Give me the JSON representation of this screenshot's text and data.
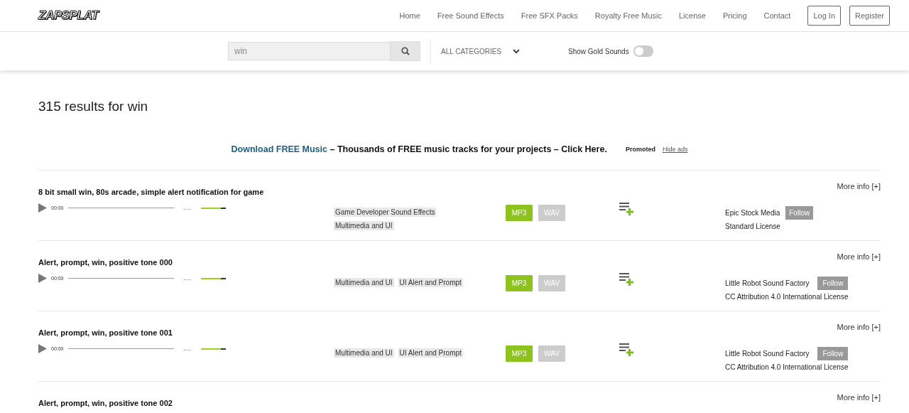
{
  "logo": "ZAPSPLAT",
  "nav": [
    "Home",
    "Free Sound Effects",
    "Free SFX Packs",
    "Royalty Free Music",
    "License",
    "Pricing",
    "Contact"
  ],
  "auth_buttons": [
    "Log In",
    "Register"
  ],
  "search": {
    "value": "win",
    "category": "ALL CATEGORIES",
    "gold_label": "Show Gold Sounds",
    "gold_on": false
  },
  "results_heading": "315 results for win",
  "promo": {
    "link": "Download FREE Music",
    "text": " – Thousands of FREE music tracks for your projects – Click Here.",
    "promoted": "Promoted",
    "hide": "Hide ads"
  },
  "results": [
    {
      "title": "8 bit small win, 80s arcade, simple alert notification for game",
      "time": "00:00",
      "level": 0.8,
      "tags": [
        "Game Developer Sound Effects",
        "Multimedia and UI"
      ],
      "formats": [
        {
          "label": "MP3",
          "available": true
        },
        {
          "label": "WAV",
          "available": false
        }
      ],
      "author": "Epic Stock Media",
      "follow": "Follow",
      "license": "Standard License",
      "more": "More info [+]"
    },
    {
      "title": "Alert, prompt, win, positive tone 000",
      "time": "00:00",
      "level": 0.8,
      "tags": [
        "Multimedia and UI",
        "UI Alert and Prompt"
      ],
      "formats": [
        {
          "label": "MP3",
          "available": true
        },
        {
          "label": "WAV",
          "available": false
        }
      ],
      "author": "Little Robot Sound Factory",
      "follow": "Follow",
      "license": "CC Attribution 4.0 International License",
      "more": "More info [+]"
    },
    {
      "title": "Alert, prompt, win, positive tone 001",
      "time": "00:00",
      "level": 0.8,
      "tags": [
        "Multimedia and UI",
        "UI Alert and Prompt"
      ],
      "formats": [
        {
          "label": "MP3",
          "available": true
        },
        {
          "label": "WAV",
          "available": false
        }
      ],
      "author": "Little Robot Sound Factory",
      "follow": "Follow",
      "license": "CC Attribution 4.0 International License",
      "more": "More info [+]"
    },
    {
      "title": "Alert, prompt, win, positive tone 002",
      "more": "More info [+]"
    }
  ]
}
